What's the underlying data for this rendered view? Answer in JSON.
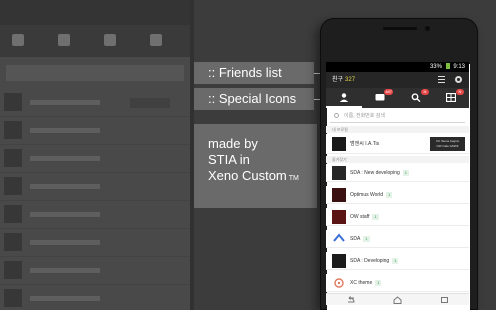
{
  "captions": {
    "friends_list": ":: Friends list",
    "special_icons": ":: Special Icons",
    "credit_line1": "made by",
    "credit_line2": "STIA in",
    "credit_line3": "Xeno Custom",
    "credit_tm": "TM"
  },
  "phone": {
    "status_bar": {
      "battery": "33%",
      "time": "9:13"
    },
    "app_bar": {
      "title": "친구",
      "friend_count": "327"
    },
    "tabs": [
      {
        "name": "friends",
        "icon": "person-icon",
        "badge": ""
      },
      {
        "name": "chats",
        "icon": "chat-icon",
        "badge": "487"
      },
      {
        "name": "find",
        "icon": "search-icon",
        "badge": "N"
      },
      {
        "name": "more",
        "icon": "more-icon",
        "badge": "N"
      }
    ],
    "search_placeholder": "이름, 전화번호 검색",
    "sections": {
      "me": "내 프로필",
      "favorites": "즐겨찾기"
    },
    "me": {
      "name": "범앤씨 I.A.Tis",
      "status_line1": "XC theme begins",
      "status_line2": "OW Cafe GSWF"
    },
    "friends": [
      {
        "name": "SDA : New developing",
        "tag": "1"
      },
      {
        "name": "Optimus World",
        "tag": "1"
      },
      {
        "name": "OW staff",
        "tag": "1"
      },
      {
        "name": "SDA",
        "tag": "1"
      },
      {
        "name": "SDA : Developing",
        "tag": "1"
      },
      {
        "name": "XC theme",
        "tag": "1"
      }
    ],
    "colors": {
      "badge_red": "#e64646",
      "count_yellow": "#e8d84e",
      "tag_green": "#3a9a53"
    }
  }
}
